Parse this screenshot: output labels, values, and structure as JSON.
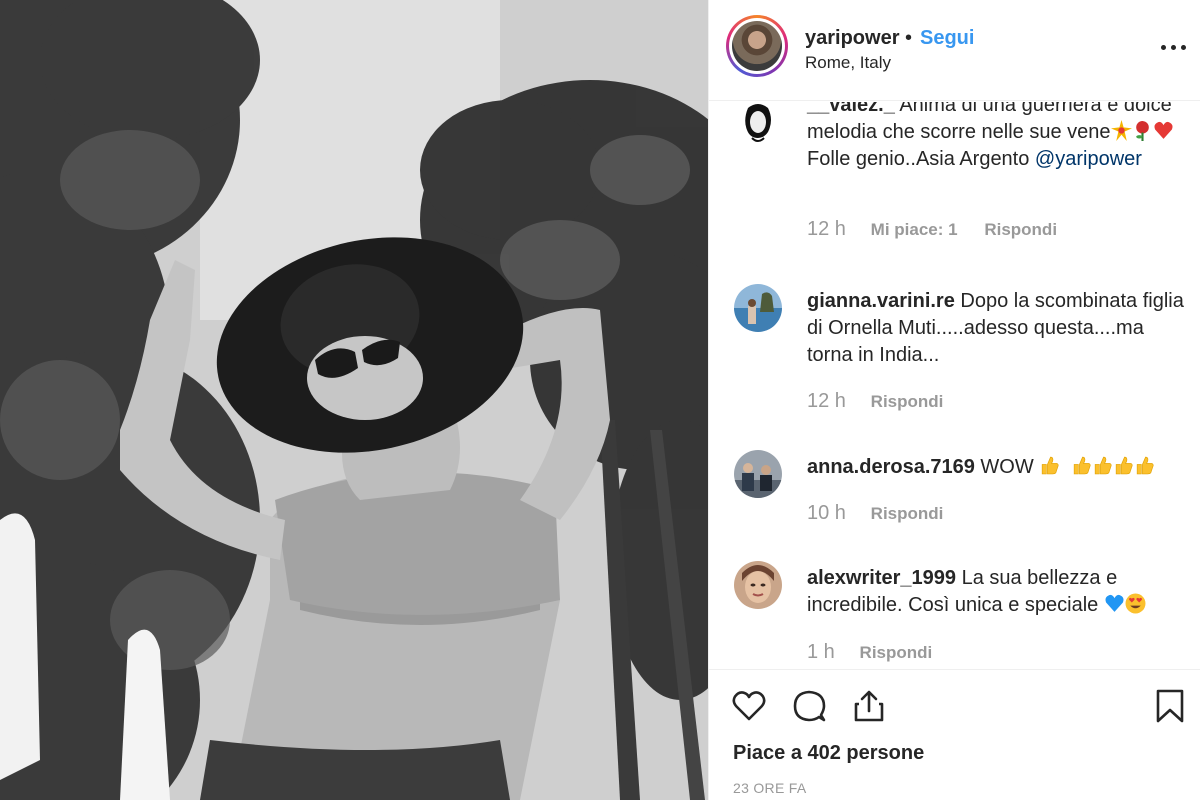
{
  "post": {
    "username": "yaripower",
    "separator": "•",
    "follow_label": "Segui",
    "location": "Rome, Italy"
  },
  "comments": [
    {
      "username": "__valez._",
      "text_1": " Anima di una guerriera e dolce melodia che scorre nelle sue vene",
      "emojis": [
        "sparkle",
        "rose",
        "heart"
      ],
      "text_2": " Folle genio..Asia Argento ",
      "mention": "@yaripower",
      "time": "12 h",
      "likes": "Mi piace: 1",
      "reply": "Rispondi"
    },
    {
      "username": "gianna.varini.re",
      "text_1": " Dopo la scombinata figlia di Ornella Muti.....adesso questa....ma torna in India...",
      "time": "12 h",
      "reply": "Rispondi"
    },
    {
      "username": "anna.derosa.7169",
      "text_1": " WOW ",
      "emojis": [
        "thumbs-up",
        "thumbs-up",
        "thumbs-up",
        "thumbs-up",
        "thumbs-up"
      ],
      "time": "10 h",
      "reply": "Rispondi"
    },
    {
      "username": "alexwriter_1999",
      "text_1": " La sua bellezza e incredibile. Così unica e speciale ",
      "emojis": [
        "blue-heart",
        "heart-eyes"
      ],
      "time": "1 h",
      "reply": "Rispondi"
    }
  ],
  "actions": {
    "icons": [
      "heart-icon",
      "comment-icon",
      "share-icon",
      "bookmark-icon"
    ],
    "likes_text": "Piace a 402 persone",
    "time_ago": "23 ORE FA"
  },
  "colors": {
    "follow": "#3897f0",
    "mention": "#003569",
    "muted": "#999999",
    "text": "#262626"
  }
}
